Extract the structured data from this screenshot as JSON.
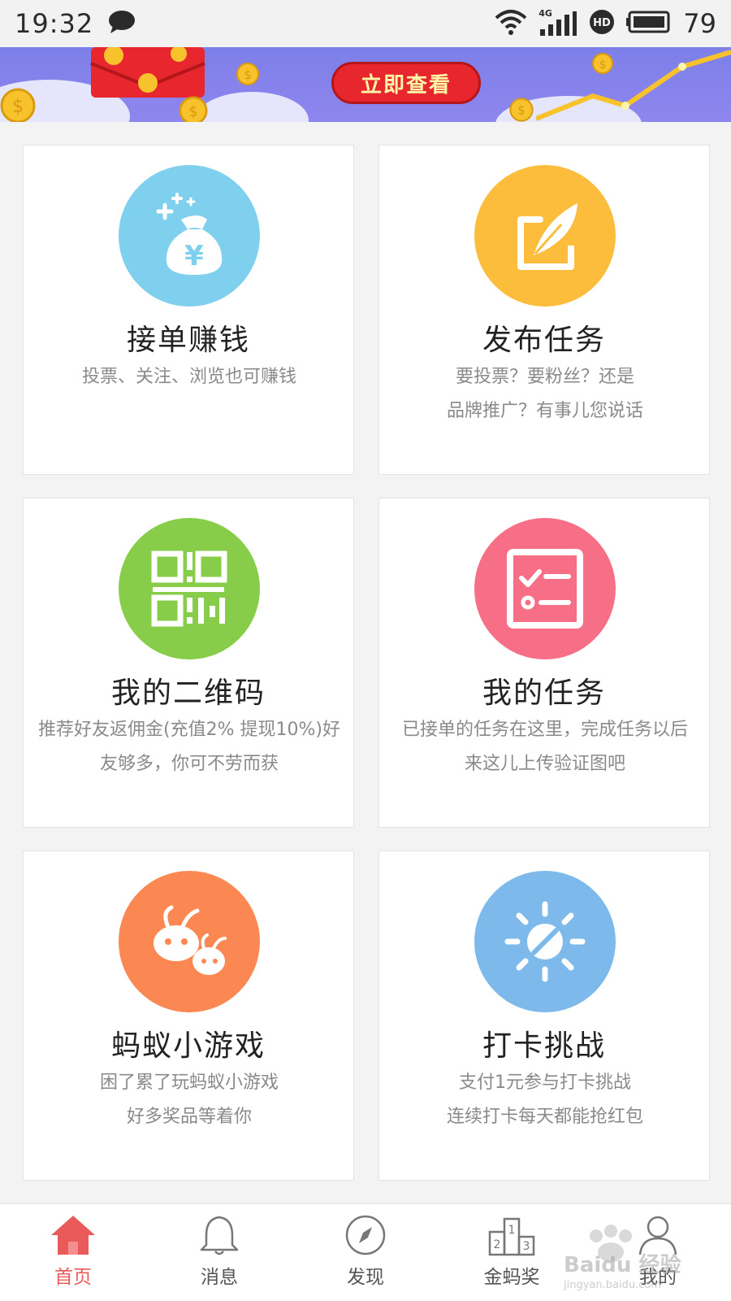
{
  "status_bar": {
    "time": "19:32",
    "network": "4G",
    "battery": "79"
  },
  "banner": {
    "button_label": "立即查看"
  },
  "cards": [
    {
      "title": "接单赚钱",
      "desc_lines": [
        "投票、关注、浏览也可赚钱"
      ],
      "icon": "money-bag-icon",
      "color": "#7fd0ee"
    },
    {
      "title": "发布任务",
      "desc_lines": [
        "要投票？要粉丝？还是",
        "品牌推广？有事儿您说话"
      ],
      "icon": "feather-pen-icon",
      "color": "#fbbd3b"
    },
    {
      "title": "我的二维码",
      "desc_lines": [
        "推荐好友返佣金(充值2% 提现10%)好",
        "友够多，你可不劳而获"
      ],
      "icon": "qr-code-icon",
      "color": "#87cd4a"
    },
    {
      "title": "我的任务",
      "desc_lines": [
        "已接单的任务在这里，完成任务以后",
        "来这儿上传验证图吧"
      ],
      "icon": "task-list-icon",
      "color": "#f76f86"
    },
    {
      "title": "蚂蚁小游戏",
      "desc_lines": [
        "困了累了玩蚂蚁小游戏",
        "好多奖品等着你"
      ],
      "icon": "ant-game-icon",
      "color": "#fb8852"
    },
    {
      "title": "打卡挑战",
      "desc_lines": [
        "支付1元参与打卡挑战",
        "连续打卡每天都能抢红包"
      ],
      "icon": "sun-challenge-icon",
      "color": "#7eb9ec"
    }
  ],
  "bottom_nav": [
    {
      "label": "首页",
      "icon": "home-icon",
      "active": true
    },
    {
      "label": "消息",
      "icon": "bell-icon",
      "active": false
    },
    {
      "label": "发现",
      "icon": "compass-icon",
      "active": false
    },
    {
      "label": "金蚂奖",
      "icon": "podium-icon",
      "active": false
    },
    {
      "label": "我的",
      "icon": "user-icon",
      "active": false
    }
  ],
  "colors": {
    "accent": "#e95b5b",
    "banner_bg": "#8f86ef",
    "banner_button": "#e8262d"
  }
}
